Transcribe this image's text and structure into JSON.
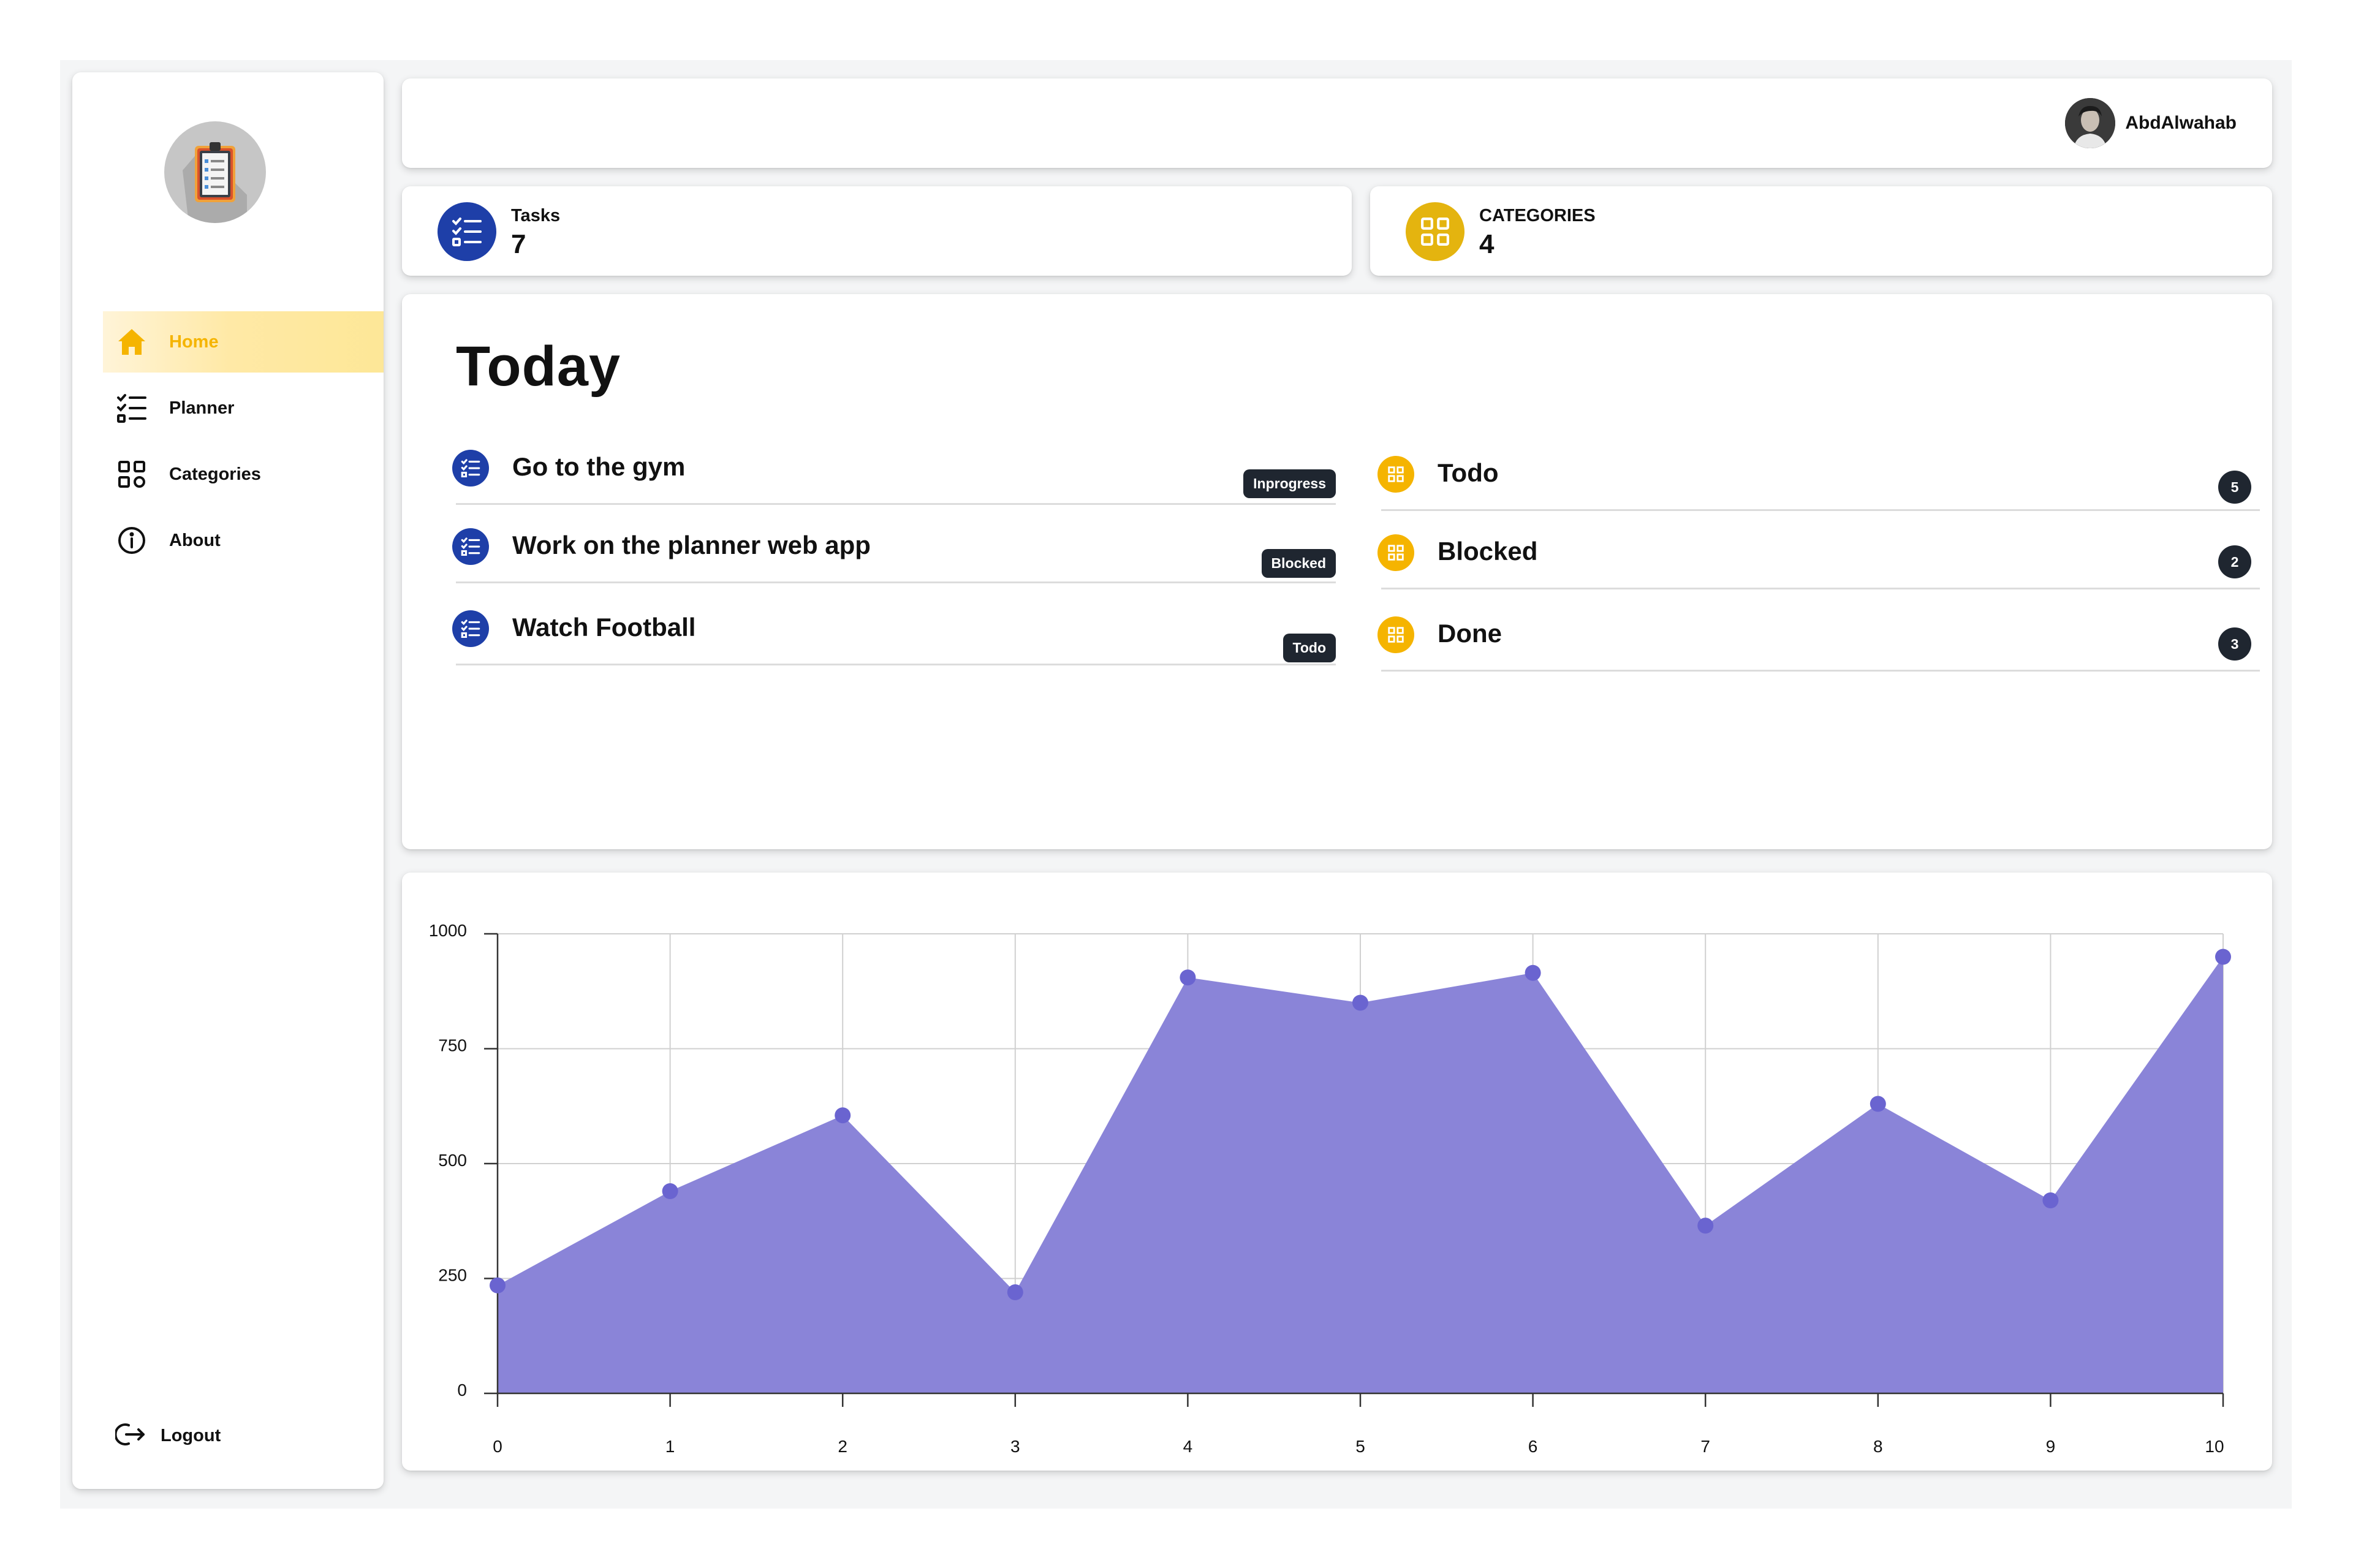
{
  "sidebar": {
    "nav": [
      {
        "label": "Home",
        "icon": "home-icon",
        "active": true
      },
      {
        "label": "Planner",
        "icon": "checklist-icon",
        "active": false
      },
      {
        "label": "Categories",
        "icon": "grid-icon",
        "active": false
      },
      {
        "label": "About",
        "icon": "info-icon",
        "active": false
      }
    ],
    "logout_label": "Logout"
  },
  "header": {
    "user_name": "AbdAlwahab"
  },
  "stats": {
    "tasks": {
      "label": "Tasks",
      "value": "7",
      "icon": "checklist-icon",
      "color": "#1e3fa8"
    },
    "categories": {
      "label": "CATEGORIES",
      "value": "4",
      "icon": "grid-icon",
      "color": "#e4b40f"
    }
  },
  "today": {
    "title": "Today",
    "tasks": [
      {
        "name": "Go to the gym",
        "status": "Inprogress"
      },
      {
        "name": "Work on the planner web app",
        "status": "Blocked"
      },
      {
        "name": "Watch Football",
        "status": "Todo"
      }
    ],
    "categories": [
      {
        "name": "Todo",
        "count": "5"
      },
      {
        "name": "Blocked",
        "count": "2"
      },
      {
        "name": "Done",
        "count": "3"
      }
    ]
  },
  "colors": {
    "accent_yellow": "#f5b400",
    "task_blue": "#1e3fa8",
    "badge_dark": "#1f2630",
    "area_fill": "#8a84d8",
    "point": "#6a64d0"
  },
  "chart_data": {
    "type": "area",
    "x": [
      0,
      1,
      2,
      3,
      4,
      5,
      6,
      7,
      8,
      9,
      10
    ],
    "values": [
      235,
      440,
      605,
      220,
      905,
      850,
      915,
      365,
      630,
      420,
      950
    ],
    "ylim": [
      0,
      1000
    ],
    "yticks": [
      0,
      250,
      500,
      750,
      1000
    ],
    "xticks": [
      0,
      1,
      2,
      3,
      4,
      5,
      6,
      7,
      8,
      9,
      10
    ],
    "grid": true
  }
}
